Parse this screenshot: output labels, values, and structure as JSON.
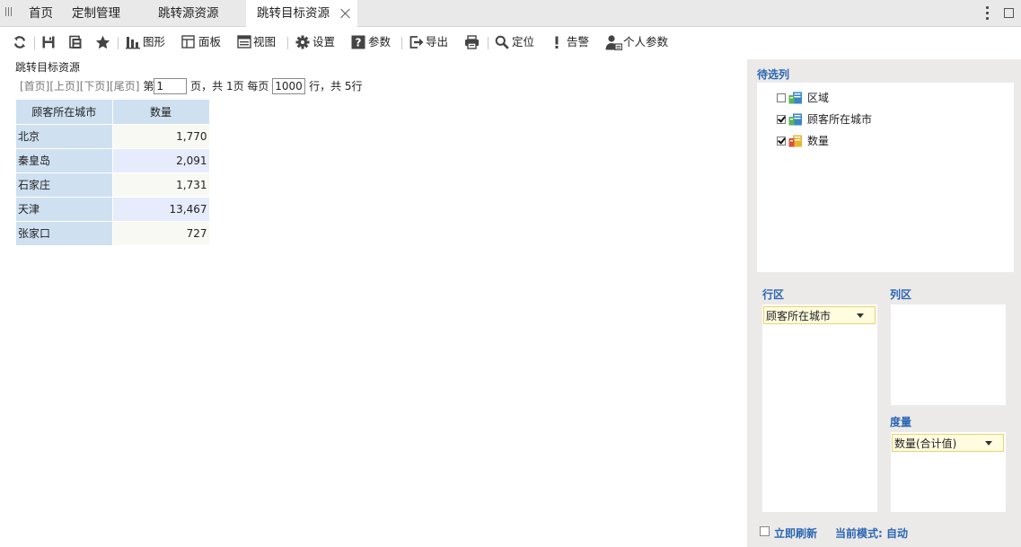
{
  "tabs": {
    "home": "首页",
    "custom_manage": "定制管理",
    "jump_source": "跳转源资源",
    "jump_target": "跳转目标资源"
  },
  "toolbar": {
    "chart": "图形",
    "panel": "面板",
    "view": "视图",
    "settings": "设置",
    "params": "参数",
    "export": "导出",
    "locate": "定位",
    "alert": "告警",
    "personal_params": "个人参数"
  },
  "report": {
    "title": "跳转目标资源",
    "pager": {
      "first": "[首页]",
      "prev": "[上页]",
      "next": "[下页]",
      "last": "[尾页]",
      "page_prefix": "第",
      "page_value": "1",
      "page_suffix": "页，共 1页 每页",
      "rows_value": "1000",
      "rows_suffix": "行，共 5行"
    },
    "columns": [
      "顾客所在城市",
      "数量"
    ],
    "rows": [
      {
        "city": "北京",
        "qty": "1,770"
      },
      {
        "city": "秦皇岛",
        "qty": "2,091"
      },
      {
        "city": "石家庄",
        "qty": "1,731"
      },
      {
        "city": "天津",
        "qty": "13,467"
      },
      {
        "city": "张家口",
        "qty": "727"
      }
    ]
  },
  "panel": {
    "candidate_title": "待选列",
    "fields": [
      {
        "label": "区域",
        "checked": false
      },
      {
        "label": "顾客所在城市",
        "checked": true
      },
      {
        "label": "数量",
        "checked": true
      }
    ],
    "row_area_title": "行区",
    "col_area_title": "列区",
    "measure_title": "度量",
    "row_field": "顾客所在城市",
    "measure_field": "数量(合计值)",
    "refresh_label": "立即刷新",
    "mode_label": "当前模式: 自动"
  },
  "colors": {
    "accent": "#2b66b3",
    "header_bg": "#cfe0f1",
    "row_odd": "#f9f9f3",
    "row_even": "#e7ecfc",
    "panel_bg": "#eceae9"
  }
}
